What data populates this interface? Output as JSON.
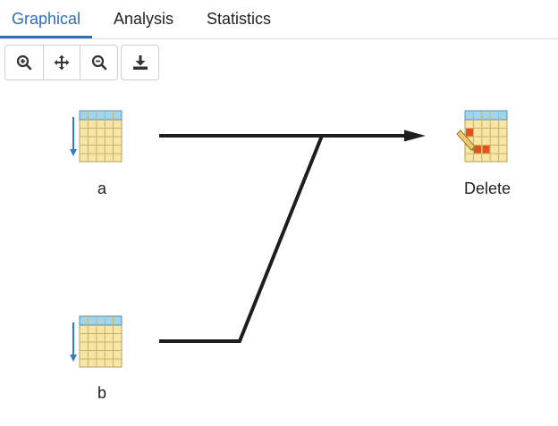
{
  "tabs": [
    {
      "label": "Graphical",
      "active": true
    },
    {
      "label": "Analysis",
      "active": false
    },
    {
      "label": "Statistics",
      "active": false
    }
  ],
  "toolbar": {
    "zoom_in": "zoom-in-icon",
    "pan": "move-icon",
    "zoom_out": "zoom-out-icon",
    "download": "download-icon"
  },
  "nodes": {
    "a": {
      "label": "a",
      "icon": "table-sort-icon"
    },
    "b": {
      "label": "b",
      "icon": "table-sort-icon"
    },
    "delete": {
      "label": "Delete",
      "icon": "table-edit-icon"
    }
  },
  "colors": {
    "accent": "#2f6db5",
    "table_fill": "#f7e6a6",
    "table_header": "#9fd5ef",
    "edit_mark": "#e8501c",
    "connector": "#1e1e1e"
  }
}
